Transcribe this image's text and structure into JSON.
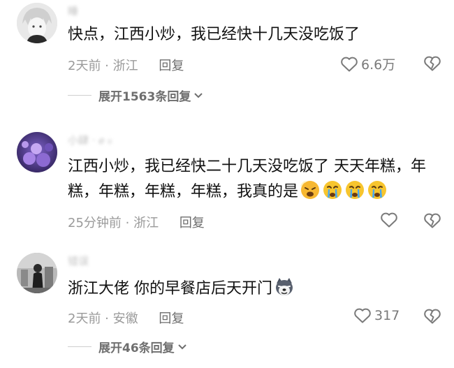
{
  "comments": [
    {
      "username": "睡",
      "text": "快点，江西小炒，我已经快十几天没吃饭了",
      "time": "2天前",
      "location": "浙江",
      "reply_label": "回复",
      "likes": "6.6万",
      "expand": {
        "label": "展开1563条回复"
      }
    },
    {
      "username": "小肆 · 𝑒 ₀",
      "text": "江西小炒，我已经快二十几天没吃饭了 天天年糕，年糕，年糕，年糕，年糕，我真的是",
      "emojis": [
        "tired-face",
        "crying-face",
        "crying-face",
        "crying-face"
      ],
      "time": "25分钟前",
      "location": "浙江",
      "reply_label": "回复"
    },
    {
      "username": "错误",
      "text": "浙江大佬 你的早餐店后天开门",
      "emojis": [
        "husky-face"
      ],
      "time": "2天前",
      "location": "安徽",
      "reply_label": "回复",
      "likes": "317",
      "expand": {
        "label": "展开46条回复"
      }
    }
  ],
  "separator": " · "
}
